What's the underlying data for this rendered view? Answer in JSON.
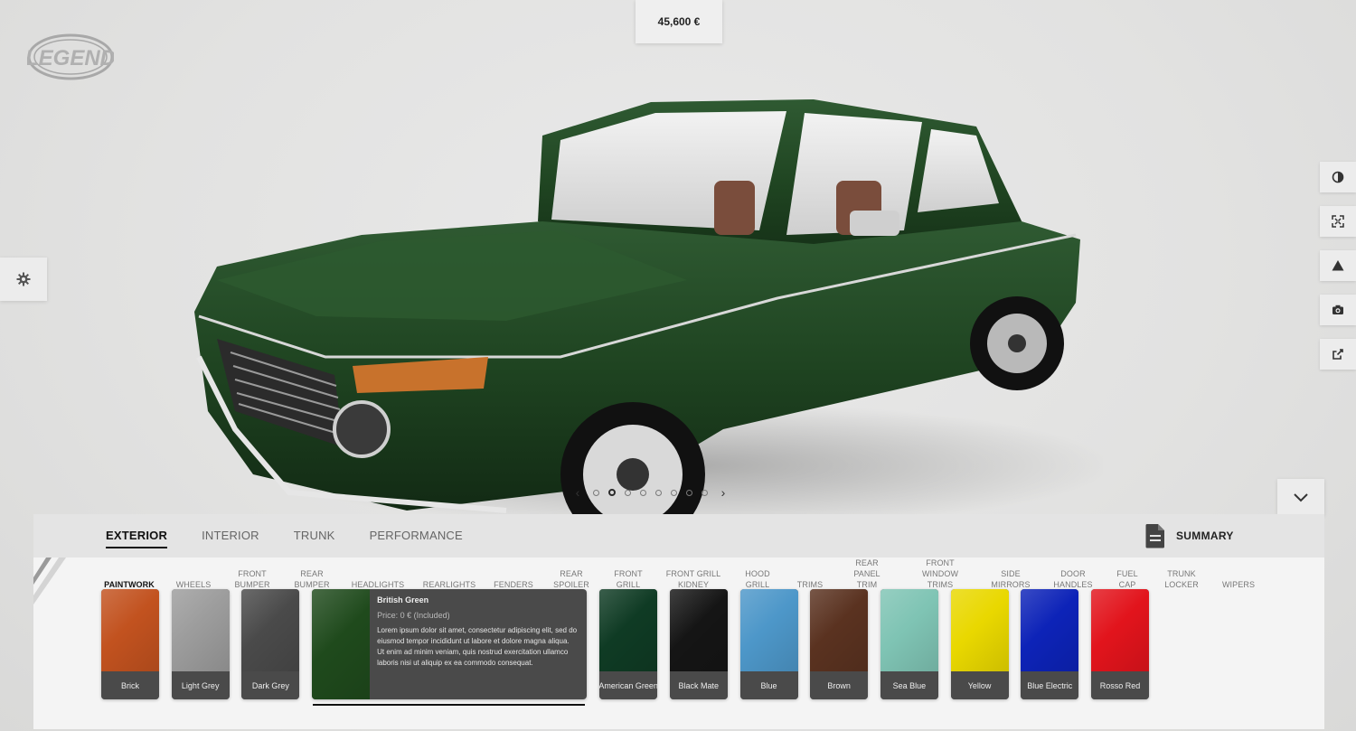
{
  "brand": {
    "logo_text": "LEGEND"
  },
  "price": {
    "total": "45,600 €"
  },
  "carousel": {
    "dots": 8,
    "active_index": 1
  },
  "main_tabs": [
    {
      "label": "EXTERIOR",
      "active": true
    },
    {
      "label": "INTERIOR",
      "active": false
    },
    {
      "label": "TRUNK",
      "active": false
    },
    {
      "label": "PERFORMANCE",
      "active": false
    }
  ],
  "summary": {
    "label": "SUMMARY"
  },
  "sub_tabs": [
    {
      "line1": "PAINTWORK",
      "line2": "",
      "active": true
    },
    {
      "line1": "WHEELS",
      "line2": ""
    },
    {
      "line1": "FRONT",
      "line2": "BUMPER"
    },
    {
      "line1": "REAR",
      "line2": "BUMPER"
    },
    {
      "line1": "HEADLIGHTS",
      "line2": ""
    },
    {
      "line1": "REARLIGHTS",
      "line2": ""
    },
    {
      "line1": "FENDERS",
      "line2": ""
    },
    {
      "line1": "REAR",
      "line2": "SPOILER"
    },
    {
      "line1": "FRONT",
      "line2": "GRILL"
    },
    {
      "line1": "FRONT GRILL",
      "line2": "KIDNEY"
    },
    {
      "line1": "HOOD",
      "line2": "GRILL"
    },
    {
      "line1": "TRIMS",
      "line2": ""
    },
    {
      "line1": "REAR",
      "line2": "PANEL",
      "line3": "TRIM"
    },
    {
      "line1": "FRONT",
      "line2": "WINDOW",
      "line3": "TRIMS"
    },
    {
      "line1": "SIDE",
      "line2": "MIRRORS"
    },
    {
      "line1": "DOOR",
      "line2": "HANDLES"
    },
    {
      "line1": "FUEL",
      "line2": "CAP"
    },
    {
      "line1": "TRUNK",
      "line2": "LOCKER"
    },
    {
      "line1": "WIPERS",
      "line2": ""
    }
  ],
  "paints": [
    {
      "name": "Brick",
      "color": "#c2521f"
    },
    {
      "name": "Light Grey",
      "color": "#9c9c9c"
    },
    {
      "name": "Dark Grey",
      "color": "#4a4a4a"
    },
    {
      "name": "British Green",
      "color": "#1f4a1c",
      "selected": true,
      "price": "Price: 0 € (Included)",
      "description": "Lorem ipsum dolor sit amet, consectetur adipiscing elit, sed do eiusmod tempor incididunt ut labore et dolore magna aliqua. Ut enim ad minim veniam, quis nostrud exercitation ullamco laboris nisi ut aliquip ex ea commodo consequat."
    },
    {
      "name": "American Green",
      "color": "#0f3b24"
    },
    {
      "name": "Black Mate",
      "color": "#151515"
    },
    {
      "name": "Blue",
      "color": "#4d97c9"
    },
    {
      "name": "Brown",
      "color": "#5a3220"
    },
    {
      "name": "Sea Blue",
      "color": "#7fc4b4"
    },
    {
      "name": "Yellow",
      "color": "#e9d800"
    },
    {
      "name": "Blue Electric",
      "color": "#0d23b8"
    },
    {
      "name": "Rosso Red",
      "color": "#e2141c"
    }
  ]
}
